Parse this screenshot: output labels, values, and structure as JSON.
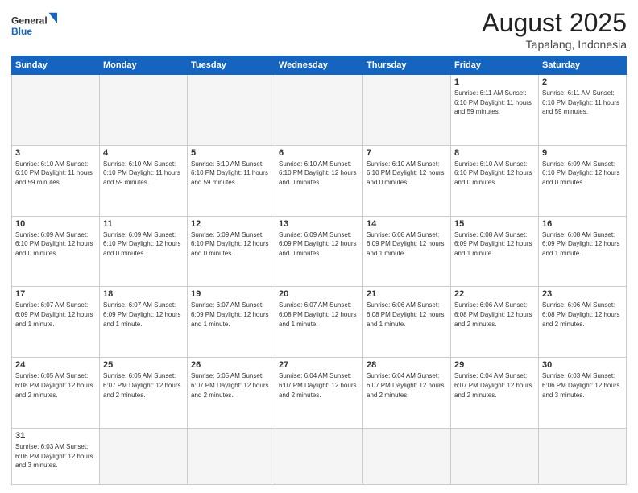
{
  "logo": {
    "text_general": "General",
    "text_blue": "Blue"
  },
  "header": {
    "month": "August 2025",
    "location": "Tapalang, Indonesia"
  },
  "days_of_week": [
    "Sunday",
    "Monday",
    "Tuesday",
    "Wednesday",
    "Thursday",
    "Friday",
    "Saturday"
  ],
  "weeks": [
    [
      {
        "day": "",
        "info": ""
      },
      {
        "day": "",
        "info": ""
      },
      {
        "day": "",
        "info": ""
      },
      {
        "day": "",
        "info": ""
      },
      {
        "day": "",
        "info": ""
      },
      {
        "day": "1",
        "info": "Sunrise: 6:11 AM\nSunset: 6:10 PM\nDaylight: 11 hours\nand 59 minutes."
      },
      {
        "day": "2",
        "info": "Sunrise: 6:11 AM\nSunset: 6:10 PM\nDaylight: 11 hours\nand 59 minutes."
      }
    ],
    [
      {
        "day": "3",
        "info": "Sunrise: 6:10 AM\nSunset: 6:10 PM\nDaylight: 11 hours\nand 59 minutes."
      },
      {
        "day": "4",
        "info": "Sunrise: 6:10 AM\nSunset: 6:10 PM\nDaylight: 11 hours\nand 59 minutes."
      },
      {
        "day": "5",
        "info": "Sunrise: 6:10 AM\nSunset: 6:10 PM\nDaylight: 11 hours\nand 59 minutes."
      },
      {
        "day": "6",
        "info": "Sunrise: 6:10 AM\nSunset: 6:10 PM\nDaylight: 12 hours\nand 0 minutes."
      },
      {
        "day": "7",
        "info": "Sunrise: 6:10 AM\nSunset: 6:10 PM\nDaylight: 12 hours\nand 0 minutes."
      },
      {
        "day": "8",
        "info": "Sunrise: 6:10 AM\nSunset: 6:10 PM\nDaylight: 12 hours\nand 0 minutes."
      },
      {
        "day": "9",
        "info": "Sunrise: 6:09 AM\nSunset: 6:10 PM\nDaylight: 12 hours\nand 0 minutes."
      }
    ],
    [
      {
        "day": "10",
        "info": "Sunrise: 6:09 AM\nSunset: 6:10 PM\nDaylight: 12 hours\nand 0 minutes."
      },
      {
        "day": "11",
        "info": "Sunrise: 6:09 AM\nSunset: 6:10 PM\nDaylight: 12 hours\nand 0 minutes."
      },
      {
        "day": "12",
        "info": "Sunrise: 6:09 AM\nSunset: 6:10 PM\nDaylight: 12 hours\nand 0 minutes."
      },
      {
        "day": "13",
        "info": "Sunrise: 6:09 AM\nSunset: 6:09 PM\nDaylight: 12 hours\nand 0 minutes."
      },
      {
        "day": "14",
        "info": "Sunrise: 6:08 AM\nSunset: 6:09 PM\nDaylight: 12 hours\nand 1 minute."
      },
      {
        "day": "15",
        "info": "Sunrise: 6:08 AM\nSunset: 6:09 PM\nDaylight: 12 hours\nand 1 minute."
      },
      {
        "day": "16",
        "info": "Sunrise: 6:08 AM\nSunset: 6:09 PM\nDaylight: 12 hours\nand 1 minute."
      }
    ],
    [
      {
        "day": "17",
        "info": "Sunrise: 6:07 AM\nSunset: 6:09 PM\nDaylight: 12 hours\nand 1 minute."
      },
      {
        "day": "18",
        "info": "Sunrise: 6:07 AM\nSunset: 6:09 PM\nDaylight: 12 hours\nand 1 minute."
      },
      {
        "day": "19",
        "info": "Sunrise: 6:07 AM\nSunset: 6:09 PM\nDaylight: 12 hours\nand 1 minute."
      },
      {
        "day": "20",
        "info": "Sunrise: 6:07 AM\nSunset: 6:08 PM\nDaylight: 12 hours\nand 1 minute."
      },
      {
        "day": "21",
        "info": "Sunrise: 6:06 AM\nSunset: 6:08 PM\nDaylight: 12 hours\nand 1 minute."
      },
      {
        "day": "22",
        "info": "Sunrise: 6:06 AM\nSunset: 6:08 PM\nDaylight: 12 hours\nand 2 minutes."
      },
      {
        "day": "23",
        "info": "Sunrise: 6:06 AM\nSunset: 6:08 PM\nDaylight: 12 hours\nand 2 minutes."
      }
    ],
    [
      {
        "day": "24",
        "info": "Sunrise: 6:05 AM\nSunset: 6:08 PM\nDaylight: 12 hours\nand 2 minutes."
      },
      {
        "day": "25",
        "info": "Sunrise: 6:05 AM\nSunset: 6:07 PM\nDaylight: 12 hours\nand 2 minutes."
      },
      {
        "day": "26",
        "info": "Sunrise: 6:05 AM\nSunset: 6:07 PM\nDaylight: 12 hours\nand 2 minutes."
      },
      {
        "day": "27",
        "info": "Sunrise: 6:04 AM\nSunset: 6:07 PM\nDaylight: 12 hours\nand 2 minutes."
      },
      {
        "day": "28",
        "info": "Sunrise: 6:04 AM\nSunset: 6:07 PM\nDaylight: 12 hours\nand 2 minutes."
      },
      {
        "day": "29",
        "info": "Sunrise: 6:04 AM\nSunset: 6:07 PM\nDaylight: 12 hours\nand 2 minutes."
      },
      {
        "day": "30",
        "info": "Sunrise: 6:03 AM\nSunset: 6:06 PM\nDaylight: 12 hours\nand 3 minutes."
      }
    ],
    [
      {
        "day": "31",
        "info": "Sunrise: 6:03 AM\nSunset: 6:06 PM\nDaylight: 12 hours\nand 3 minutes."
      },
      {
        "day": "",
        "info": ""
      },
      {
        "day": "",
        "info": ""
      },
      {
        "day": "",
        "info": ""
      },
      {
        "day": "",
        "info": ""
      },
      {
        "day": "",
        "info": ""
      },
      {
        "day": "",
        "info": ""
      }
    ]
  ]
}
